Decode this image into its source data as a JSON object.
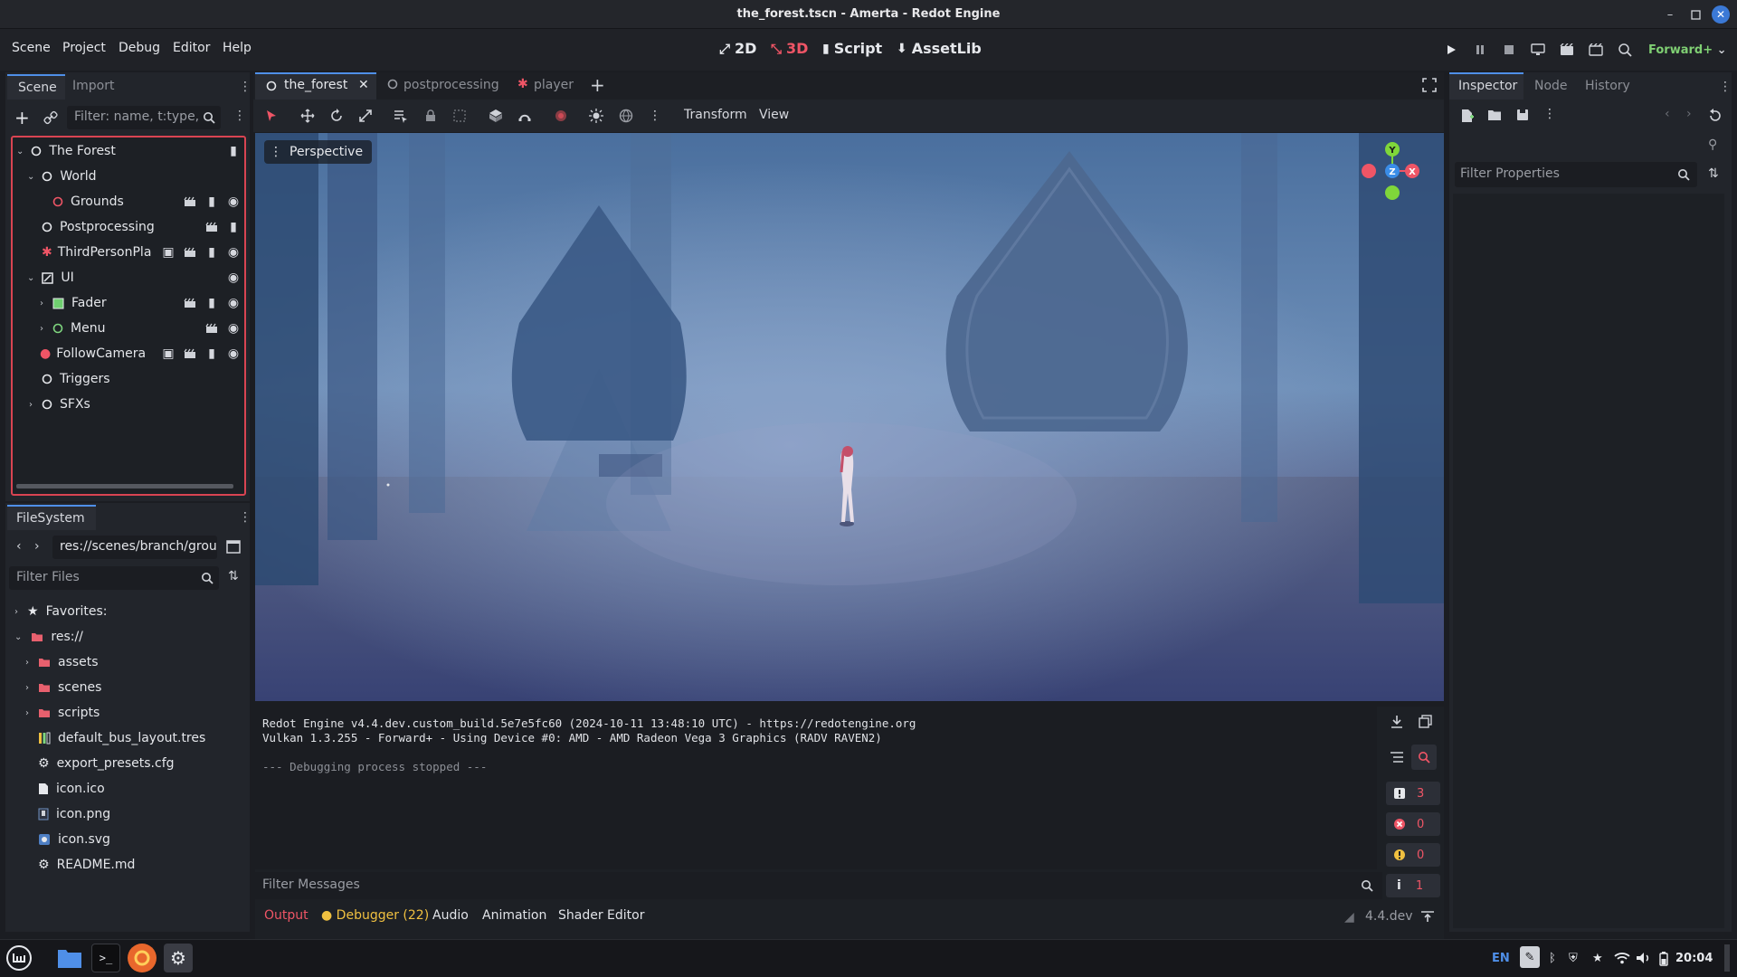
{
  "window": {
    "title": "the_forest.tscn - Amerta - Redot Engine"
  },
  "menu": {
    "items": [
      "Scene",
      "Project",
      "Debug",
      "Editor",
      "Help"
    ]
  },
  "modes": {
    "two_d": "2D",
    "three_d": "3D",
    "script": "Script",
    "assetlib": "AssetLib"
  },
  "renderer": {
    "label": "Forward+"
  },
  "scene_dock": {
    "tabs": [
      "Scene",
      "Import"
    ],
    "filter_placeholder": "Filter: name, t:type,",
    "tree": [
      {
        "label": "The Forest",
        "icon": "node3d-icon",
        "depth": 0
      },
      {
        "label": "World",
        "icon": "node3d-icon",
        "depth": 1
      },
      {
        "label": "Grounds",
        "icon": "node3d-icon",
        "depth": 2
      },
      {
        "label": "Postprocessing",
        "icon": "node3d-icon",
        "depth": 1
      },
      {
        "label": "ThirdPersonPla",
        "icon": "character-icon",
        "depth": 1
      },
      {
        "label": "UI",
        "icon": "control-icon",
        "depth": 1
      },
      {
        "label": "Fader",
        "icon": "colorrect-icon",
        "depth": 2
      },
      {
        "label": "Menu",
        "icon": "control-node-icon",
        "depth": 2
      },
      {
        "label": "FollowCamera",
        "icon": "camera-icon",
        "depth": 1
      },
      {
        "label": "Triggers",
        "icon": "node3d-icon",
        "depth": 1
      },
      {
        "label": "SFXs",
        "icon": "node3d-icon",
        "depth": 1
      }
    ]
  },
  "filesystem": {
    "title": "FileSystem",
    "path": "res://scenes/branch/grou",
    "filter_placeholder": "Filter Files",
    "items": [
      {
        "label": "Favorites:",
        "icon": "star-icon"
      },
      {
        "label": "res://",
        "icon": "folder-icon"
      },
      {
        "label": "assets",
        "icon": "folder-icon"
      },
      {
        "label": "scenes",
        "icon": "folder-icon"
      },
      {
        "label": "scripts",
        "icon": "folder-icon"
      },
      {
        "label": "default_bus_layout.tres",
        "icon": "bus-layout-icon"
      },
      {
        "label": "export_presets.cfg",
        "icon": "gear-file-icon"
      },
      {
        "label": "icon.ico",
        "icon": "file-icon"
      },
      {
        "label": "icon.png",
        "icon": "image-icon"
      },
      {
        "label": "icon.svg",
        "icon": "svg-icon"
      },
      {
        "label": "README.md",
        "icon": "gear-file-icon"
      }
    ]
  },
  "editor_tabs": [
    {
      "label": "the_forest",
      "active": true
    },
    {
      "label": "postprocessing",
      "active": false
    },
    {
      "label": "player",
      "active": false
    }
  ],
  "viewport": {
    "toolbar": {
      "transform": "Transform",
      "view": "View"
    },
    "perspective_label": "Perspective",
    "gizmo": {
      "y": "Y",
      "z": "Z",
      "x": "X"
    }
  },
  "inspector": {
    "tabs": [
      "Inspector",
      "Node",
      "History"
    ],
    "filter_placeholder": "Filter Properties"
  },
  "output": {
    "lines": [
      "Redot Engine v4.4.dev.custom_build.5e7e5fc60 (2024-10-11 13:48:10 UTC) - https://redotengine.org",
      "Vulkan 1.3.255 - Forward+ - Using Device #0: AMD - AMD Radeon Vega 3 Graphics (RADV RAVEN2)",
      "",
      "--- Debugging process stopped ---"
    ],
    "filter_placeholder": "Filter Messages",
    "counts": {
      "messages": "3",
      "errors": "0",
      "warnings": "0",
      "info": "1"
    }
  },
  "bottom_panel": {
    "tabs": [
      "Output",
      "Debugger (22)",
      "Audio",
      "Animation",
      "Shader Editor"
    ],
    "version": "4.4.dev"
  },
  "taskbar": {
    "lang": "EN",
    "time": "20:04"
  },
  "colors": {
    "accent_red": "#ef5566",
    "accent_blue": "#4f8fe8",
    "panel": "#22252b"
  }
}
